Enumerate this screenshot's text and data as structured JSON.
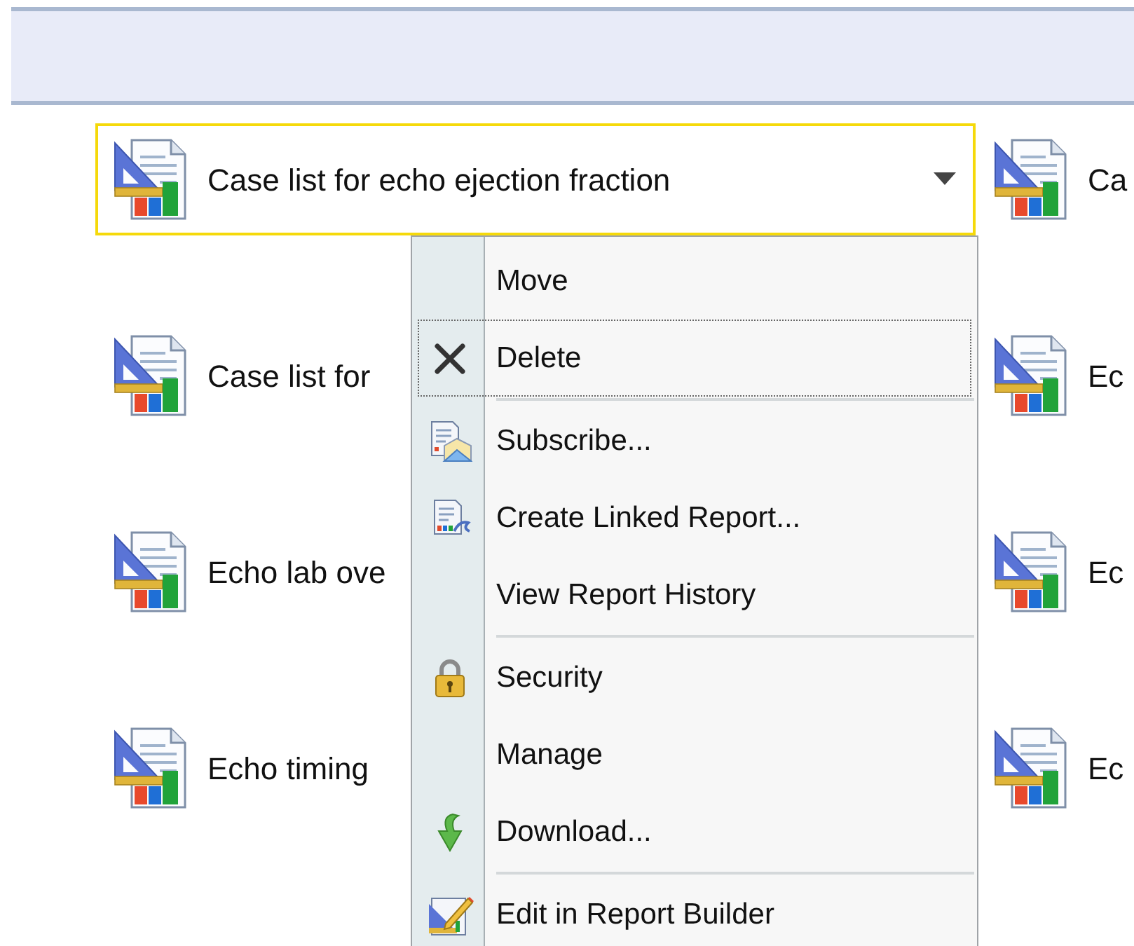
{
  "rows": [
    {
      "left": {
        "name": "Case list for echo ejection fraction",
        "selected": true
      },
      "right": {
        "name": "Ca",
        "selected": false
      }
    },
    {
      "left": {
        "name": "Case list for",
        "selected": false
      },
      "right": {
        "name": "Ec",
        "selected": false
      }
    },
    {
      "left": {
        "name": "Echo lab ove",
        "selected": false
      },
      "right": {
        "name": "Ec",
        "selected": false
      }
    },
    {
      "left": {
        "name": "Echo timing",
        "selected": false
      },
      "right": {
        "name": "Ec",
        "selected": false
      }
    }
  ],
  "context_menu": {
    "items": [
      {
        "kind": "plain",
        "label": "Move",
        "focused": false
      },
      {
        "kind": "delete",
        "label": "Delete",
        "focused": true
      },
      {
        "kind": "separator"
      },
      {
        "kind": "subscribe",
        "label": "Subscribe...",
        "focused": false
      },
      {
        "kind": "linked",
        "label": "Create Linked Report...",
        "focused": false
      },
      {
        "kind": "plain",
        "label": "View Report History",
        "focused": false
      },
      {
        "kind": "separator"
      },
      {
        "kind": "lock",
        "label": "Security",
        "focused": false
      },
      {
        "kind": "plain",
        "label": "Manage",
        "focused": false
      },
      {
        "kind": "download",
        "label": "Download...",
        "focused": false
      },
      {
        "kind": "separator"
      },
      {
        "kind": "builder",
        "label": "Edit in Report Builder",
        "focused": false
      }
    ]
  }
}
